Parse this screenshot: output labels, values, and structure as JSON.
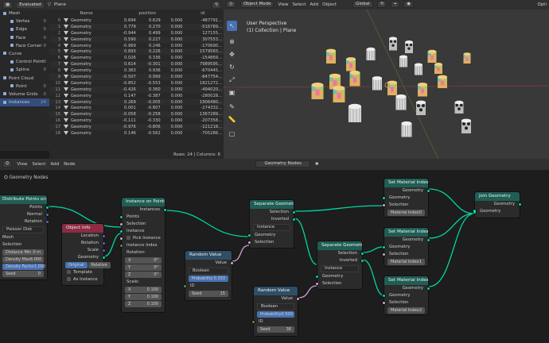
{
  "spreadsheet": {
    "mode": "Evaluated",
    "object": "Plane",
    "columns": [
      "Name",
      "position",
      "id"
    ],
    "rows": [
      [
        "0",
        "Geometry",
        "0.694",
        "0.629",
        "0.000",
        "-487791..."
      ],
      [
        "1",
        "Geometry",
        "0.779",
        "0.270",
        "0.000",
        "-516789..."
      ],
      [
        "2",
        "Geometry",
        "-0.944",
        "0.499",
        "0.000",
        "127155..."
      ],
      [
        "3",
        "Geometry",
        "0.590",
        "0.227",
        "0.000",
        "307553..."
      ],
      [
        "4",
        "Geometry",
        "-0.969",
        "0.246",
        "0.000",
        "-170690..."
      ],
      [
        "5",
        "Geometry",
        "0.893",
        "0.226",
        "0.000",
        "1579583..."
      ],
      [
        "6",
        "Geometry",
        "0.026",
        "0.336",
        "0.000",
        "-154869..."
      ],
      [
        "7",
        "Geometry",
        "0.614",
        "-0.301",
        "0.000",
        "7989595..."
      ],
      [
        "8",
        "Geometry",
        "0.363",
        "0.936",
        "0.000",
        "-670445..."
      ],
      [
        "9",
        "Geometry",
        "-0.507",
        "0.999",
        "0.000",
        "-847754..."
      ],
      [
        "10",
        "Geometry",
        "-0.852",
        "-0.553",
        "0.000",
        "1821272..."
      ],
      [
        "11",
        "Geometry",
        "-0.426",
        "0.360",
        "0.000",
        "-494020..."
      ],
      [
        "12",
        "Geometry",
        "0.147",
        "-0.387",
        "0.000",
        "-280028..."
      ],
      [
        "13",
        "Geometry",
        "0.269",
        "-0.005",
        "0.000",
        "1906480..."
      ],
      [
        "14",
        "Geometry",
        "0.001",
        "-0.807",
        "0.000",
        "-274332..."
      ],
      [
        "15",
        "Geometry",
        "-0.058",
        "-0.258",
        "0.000",
        "1367289..."
      ],
      [
        "16",
        "Geometry",
        "-0.111",
        "-0.330",
        "0.000",
        "-207358..."
      ],
      [
        "17",
        "Geometry",
        "-0.976",
        "-0.806",
        "0.000",
        "-121218..."
      ],
      [
        "18",
        "Geometry",
        "0.146",
        "-0.562",
        "0.000",
        "-705286..."
      ]
    ],
    "footer": "Rows: 24   |   Columns: 6"
  },
  "outliner": [
    {
      "label": "Mesh",
      "count": "",
      "color": "#8fb0e0",
      "indent": 0
    },
    {
      "label": "Vertex",
      "count": "0",
      "color": "#8fb0e0",
      "indent": 1
    },
    {
      "label": "Edge",
      "count": "0",
      "color": "#8fb0e0",
      "indent": 1
    },
    {
      "label": "Face",
      "count": "0",
      "color": "#8fb0e0",
      "indent": 1
    },
    {
      "label": "Face Corner",
      "count": "0",
      "color": "#8fb0e0",
      "indent": 1
    },
    {
      "label": "Curve",
      "count": "",
      "color": "#8fb0e0",
      "indent": 0
    },
    {
      "label": "Control Point",
      "count": "0",
      "color": "#8fb0e0",
      "indent": 1
    },
    {
      "label": "Spline",
      "count": "0",
      "color": "#8fb0e0",
      "indent": 1
    },
    {
      "label": "Point Cloud",
      "count": "",
      "color": "#8fb0e0",
      "indent": 0
    },
    {
      "label": "Point",
      "count": "0",
      "color": "#8fb0e0",
      "indent": 1
    },
    {
      "label": "Volume Grids",
      "count": "0",
      "color": "#8fb0e0",
      "indent": 0
    },
    {
      "label": "Instances",
      "count": "24",
      "color": "#8fb0e0",
      "indent": 0,
      "selected": true
    }
  ],
  "viewport": {
    "mode": "Object Mode",
    "menus": [
      "View",
      "Select",
      "Add",
      "Object"
    ],
    "orientation": "Global",
    "options": "Opti",
    "perspective": "User Perspective",
    "collection": "(1) Collection | Plane"
  },
  "node_editor": {
    "menus": [
      "View",
      "Select",
      "Add",
      "Node"
    ],
    "tree": "Geometry Nodes",
    "breadcrumb": "Geometry Nodes"
  },
  "nodes": {
    "distribute": {
      "title": "Distribute Points on Faces",
      "points": "Points",
      "normal": "Normal",
      "rotation": "Rotation",
      "method": "Poisson Disk",
      "mesh": "Mesh",
      "selection": "Selection",
      "dist_label": "Distance Min",
      "dist_val": "0 m",
      "dmax_label": "Density Max",
      "dmax_val": "6.000",
      "dfac_label": "Density Factor",
      "dfac_val": "1.000",
      "seed_label": "Seed",
      "seed_val": "0"
    },
    "object_info": {
      "title": "Object Info",
      "location": "Location",
      "rotation": "Rotation",
      "scale": "Scale",
      "geometry": "Geometry",
      "original": "Original",
      "relative": "Relative",
      "template": "Template",
      "as_instance": "As Instance"
    },
    "instance": {
      "title": "Instance on Points",
      "instances": "Instances",
      "points": "Points",
      "selection": "Selection",
      "instance": "Instance",
      "pick": "Pick Instance",
      "index": "Instance Index",
      "rotation": "Rotation:",
      "x": "X",
      "y": "Y",
      "z": "Z",
      "rot_val": "0°",
      "scale": "Scale:",
      "scale_val": "0.100"
    },
    "random1": {
      "title": "Random Value",
      "value": "Value",
      "type": "Boolean",
      "prob_label": "Probability",
      "prob_val": "0.333",
      "id": "ID",
      "seed_label": "Seed",
      "seed_val": "15"
    },
    "random2": {
      "title": "Random Value",
      "value": "Value",
      "type": "Boolean",
      "prob_label": "Probability",
      "prob_val": "0.500",
      "id": "ID",
      "seed_label": "Seed",
      "seed_val": "36"
    },
    "sep1": {
      "title": "Separate Geometry",
      "selection_out": "Selection",
      "inverted": "Inverted",
      "domain": "Instance",
      "geometry": "Geometry",
      "selection": "Selection"
    },
    "sep2": {
      "title": "Separate Geometry",
      "selection_out": "Selection",
      "inverted": "Inverted",
      "domain": "Instance",
      "geometry": "Geometry",
      "selection": "Selection"
    },
    "smi0": {
      "title": "Set Material Index",
      "geometry_out": "Geometry",
      "geometry": "Geometry",
      "selection": "Selection",
      "label": "Material Index",
      "val": "0"
    },
    "smi1": {
      "title": "Set Material Index",
      "geometry_out": "Geometry",
      "geometry": "Geometry",
      "selection": "Selection",
      "label": "Material Index",
      "val": "1"
    },
    "smi2": {
      "title": "Set Material Index",
      "geometry_out": "Geometry",
      "geometry": "Geometry",
      "selection": "Selection",
      "label": "Material Index",
      "val": "2"
    },
    "join": {
      "title": "Join Geometry",
      "geometry_out": "Geometry",
      "geometry": "Geometry"
    }
  }
}
